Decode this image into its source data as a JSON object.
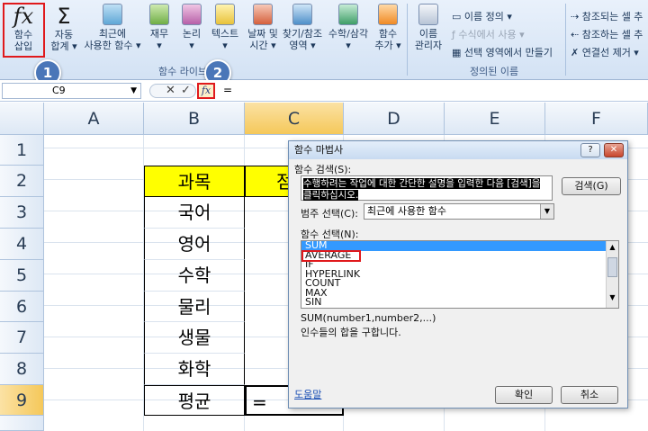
{
  "ribbon": {
    "insert_function": {
      "line1": "함수",
      "line2": "삽입",
      "symbol": "fx"
    },
    "autosum": {
      "line1": "자동",
      "line2": "합계 ▾",
      "symbol": "Σ"
    },
    "recent": {
      "line1": "최근에",
      "line2": "사용한 함수 ▾"
    },
    "financial": {
      "line1": "재무",
      "line2": "▾"
    },
    "logical": {
      "line1": "논리",
      "line2": "▾"
    },
    "text": {
      "line1": "텍스트",
      "line2": "▾"
    },
    "datetime": {
      "line1": "날짜 및",
      "line2": "시간 ▾"
    },
    "lookup": {
      "line1": "찾기/참조",
      "line2": "영역 ▾"
    },
    "math": {
      "line1": "수학/삼각",
      "line2": "▾"
    },
    "more": {
      "line1": "함수",
      "line2": "추가 ▾"
    },
    "group_function_library": "함수 라이브러리",
    "name_manager": {
      "line1": "이름",
      "line2": "관리자"
    },
    "define_name": "이름 정의 ▾",
    "use_in_formula": "수식에서 사용 ▾",
    "create_from_selection": "선택 영역에서 만들기",
    "group_defined_names": "정의된 이름",
    "trace_precedents": "참조되는 셀 추",
    "trace_dependents": "참조하는 셀 추",
    "remove_arrows": "연결선 제거 ▾"
  },
  "callouts": {
    "one": "1",
    "two": "2"
  },
  "formula_bar": {
    "name_box": "C9",
    "fx": "fx",
    "formula": "=",
    "cancel": "✕",
    "enter": "✓"
  },
  "sheet": {
    "columns": [
      "A",
      "B",
      "C",
      "D",
      "E",
      "F"
    ],
    "rows": [
      "1",
      "2",
      "3",
      "4",
      "5",
      "6",
      "7",
      "8",
      "9"
    ],
    "b_cells": [
      "",
      "과목",
      "국어",
      "영어",
      "수학",
      "물리",
      "생물",
      "화학",
      "평균"
    ],
    "c_header_partial": "점",
    "c9": "="
  },
  "dialog": {
    "title": "함수 마법사",
    "help_btn": "?",
    "close_btn": "✕",
    "search_label": "함수 검색(S):",
    "search_text": "수행하려는 작업에 대한 간단한 설명을 입력한 다음 [검색]을 클릭하십시오.",
    "search_button": "검색(G)",
    "category_label": "범주 선택(C):",
    "category_value": "최근에 사용한 함수",
    "select_label": "함수 선택(N):",
    "functions": [
      "SUM",
      "AVERAGE",
      "IF",
      "HYPERLINK",
      "COUNT",
      "MAX",
      "SIN"
    ],
    "signature": "SUM(number1,number2,...)",
    "description": "인수들의 합을 구합니다.",
    "help_link": "도움말",
    "ok": "확인",
    "cancel": "취소"
  },
  "colors": {
    "highlight_yellow": "#ffff00",
    "callout_red": "#e0191c",
    "badge_blue": "#4a76b8",
    "selected_header": "#f5c85a"
  }
}
